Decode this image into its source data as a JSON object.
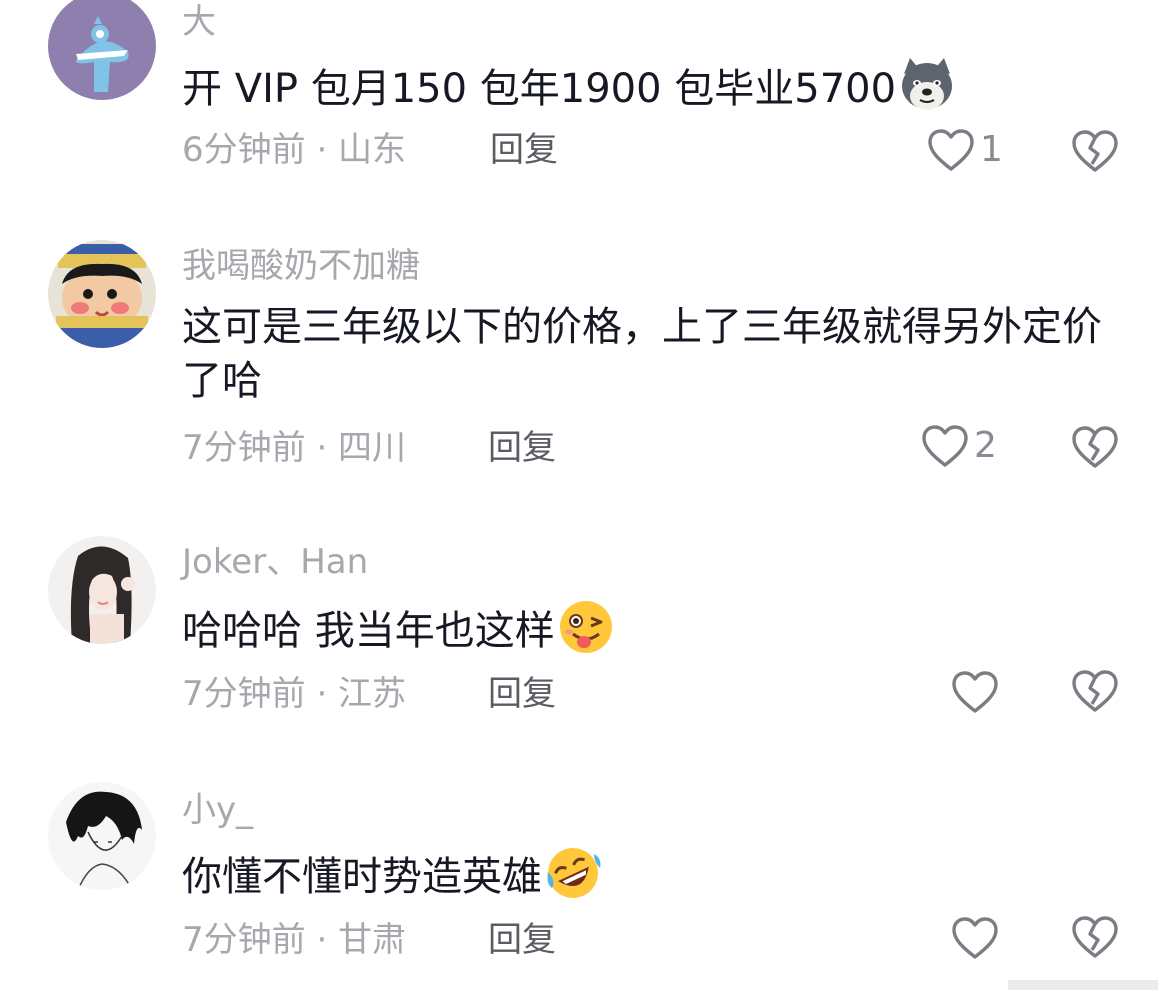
{
  "comments": [
    {
      "username": "大",
      "text": "开 VIP 包月150  包年1900 包毕业5700",
      "emoji": "dog-emoji",
      "time": "6分钟前 · 山东",
      "reply_label": "回复",
      "like_count": "1",
      "avatar": "blue-monster-avatar"
    },
    {
      "username": "我喝酸奶不加糖",
      "text": "这可是三年级以下的价格，上了三年级就得另外定价了哈",
      "time": "7分钟前 · 四川",
      "reply_label": "回复",
      "like_count": "2",
      "avatar": "cartoon-boy-avatar"
    },
    {
      "username": "Joker、Han",
      "text": "哈哈哈 我当年也这样",
      "emoji": "wink-tongue-emoji",
      "time": "7分钟前 · 江苏",
      "reply_label": "回复",
      "like_count": "",
      "avatar": "girl-photo-avatar"
    },
    {
      "username": "小y_",
      "text": "你懂不懂时势造英雄",
      "emoji": "rofl-emoji",
      "time": "7分钟前 · 甘肃",
      "reply_label": "回复",
      "like_count": "",
      "avatar": "sketch-boy-avatar"
    }
  ],
  "colors": {
    "text": "#161823",
    "muted": "#a7a7ad",
    "reply": "#5b5b63",
    "icon": "#7c7c84"
  }
}
